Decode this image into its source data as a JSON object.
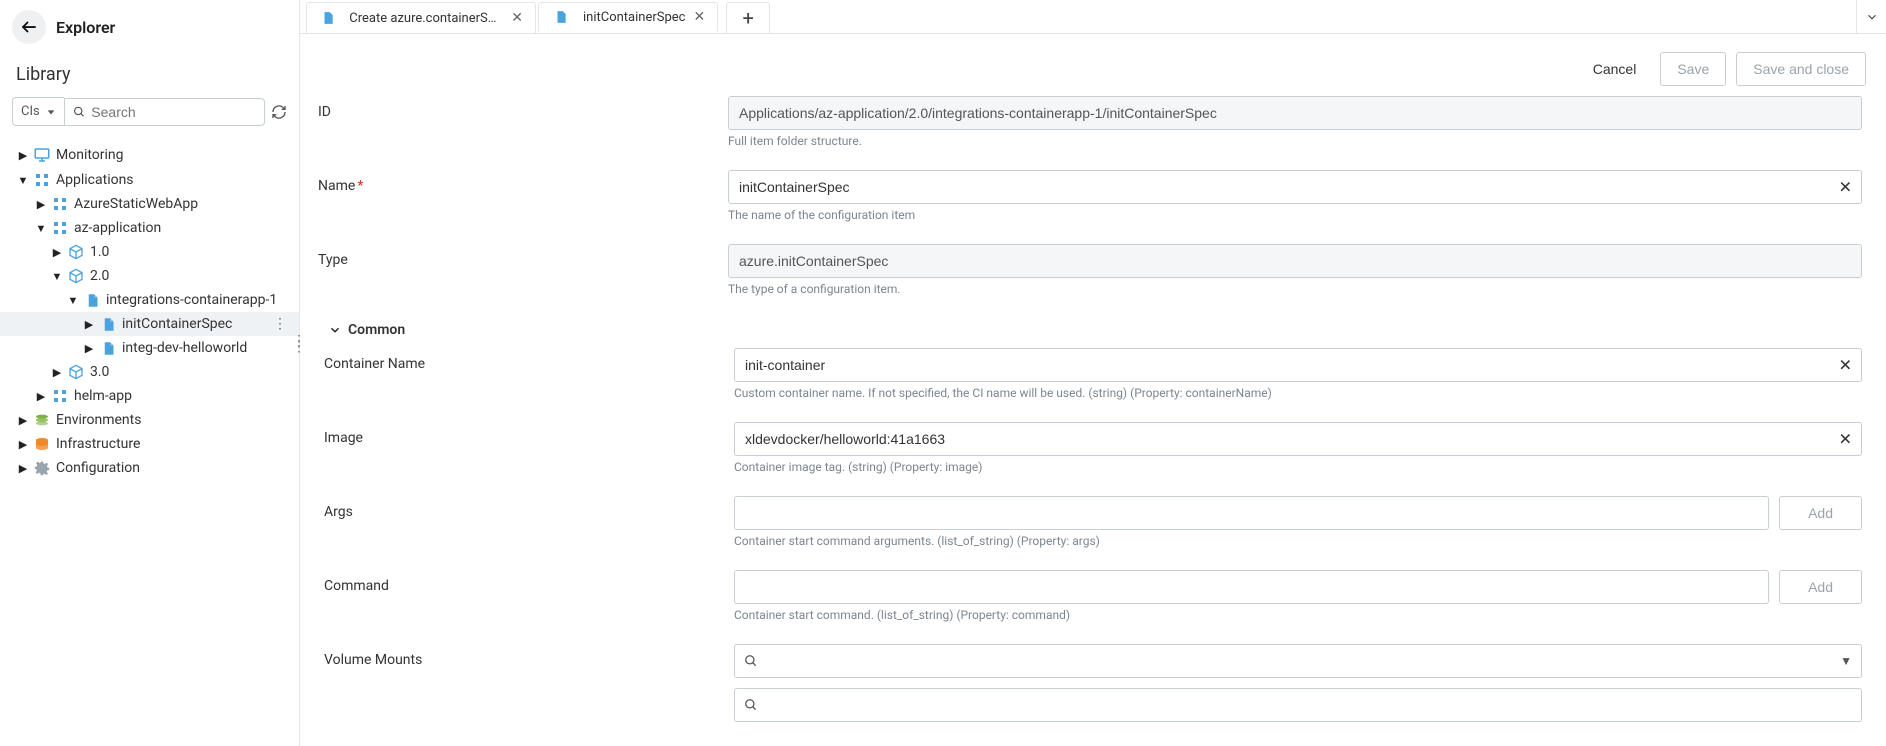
{
  "sidebar": {
    "title": "Explorer",
    "library_label": "Library",
    "cls_label": "CIs",
    "search_placeholder": "Search"
  },
  "tree": {
    "monitoring": "Monitoring",
    "applications": "Applications",
    "azureStaticWebApp": "AzureStaticWebApp",
    "azApplication": "az-application",
    "v10": "1.0",
    "v20": "2.0",
    "integrationsContainerapp": "integrations-containerapp-1",
    "initContainerSpec": "initContainerSpec",
    "integDevHelloworld": "integ-dev-helloworld",
    "v30": "3.0",
    "helmApp": "helm-app",
    "environments": "Environments",
    "infrastructure": "Infrastructure",
    "configuration": "Configuration"
  },
  "tabs": [
    {
      "label": "Create azure.containerSpec *"
    },
    {
      "label": "initContainerSpec"
    }
  ],
  "actions": {
    "cancel": "Cancel",
    "save": "Save",
    "saveAndClose": "Save and close"
  },
  "form": {
    "id": {
      "label": "ID",
      "value": "Applications/az-application/2.0/integrations-containerapp-1/initContainerSpec",
      "helper": "Full item folder structure."
    },
    "name": {
      "label": "Name",
      "value": "initContainerSpec",
      "helper": "The name of the configuration item"
    },
    "type": {
      "label": "Type",
      "value": "azure.initContainerSpec",
      "helper": "The type of a configuration item."
    },
    "commonSection": "Common",
    "containerName": {
      "label": "Container Name",
      "value": "init-container",
      "helper": "Custom container name. If not specified, the CI name will be used. (string) (Property: containerName)"
    },
    "image": {
      "label": "Image",
      "value": "xldevdocker/helloworld:41a1663",
      "helper": "Container image tag. (string) (Property: image)"
    },
    "args": {
      "label": "Args",
      "value": "",
      "addLabel": "Add",
      "helper": "Container start command arguments. (list_of_string) (Property: args)"
    },
    "command": {
      "label": "Command",
      "value": "",
      "addLabel": "Add",
      "helper": "Container start command. (list_of_string) (Property: command)"
    },
    "volumeMounts": {
      "label": "Volume Mounts"
    }
  }
}
